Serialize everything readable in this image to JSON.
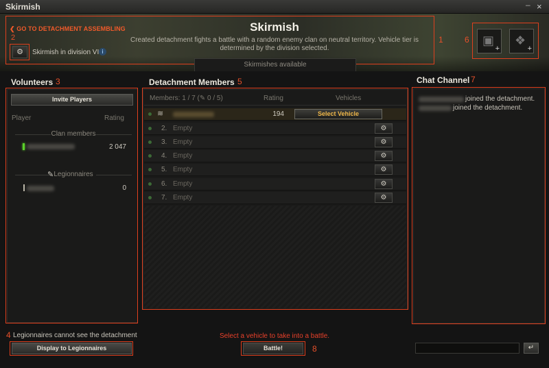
{
  "window": {
    "title": "Skirmish",
    "minimize": "–",
    "close": "×"
  },
  "header": {
    "back_link": "❮ GO TO DETACHMENT ASSEMBLING",
    "title": "Skirmish",
    "description": "Created detachment fights a battle with a random enemy clan on neutral territory. Vehicle tier is determined by the division selected.",
    "division": "Skirmish in division VI",
    "info_icon": "i",
    "availability_tab": "Skirmishes available",
    "settings_icon": "⚙",
    "icon_tiles": [
      {
        "icon": "tank-hull-icon",
        "glyph": "▣",
        "plus": "+"
      },
      {
        "icon": "consumable-icon",
        "glyph": "❖",
        "plus": "+"
      }
    ]
  },
  "annotations": [
    "1",
    "2",
    "3",
    "4",
    "5",
    "6",
    "7",
    "8"
  ],
  "volunteers": {
    "title": "Volunteers",
    "invite_button": "Invite Players",
    "col_player": "Player",
    "col_rating": "Rating",
    "clan_members_label": "Clan members",
    "clan_member": {
      "rating": "2 047"
    },
    "legionnaires_label": "Legionnaires",
    "legionnaire": {
      "rating": "0"
    }
  },
  "detachment": {
    "title": "Detachment Members",
    "members_count": "Members: 1 / 7 (",
    "legion_count": " 0 / 5)",
    "col_rating": "Rating",
    "col_vehicles": "Vehicles",
    "first_member": {
      "rating": "194",
      "select_vehicle": "Select Vehicle"
    },
    "empty_slots": [
      {
        "num": "2.",
        "label": "Empty"
      },
      {
        "num": "3.",
        "label": "Empty"
      },
      {
        "num": "4.",
        "label": "Empty"
      },
      {
        "num": "5.",
        "label": "Empty"
      },
      {
        "num": "6.",
        "label": "Empty"
      },
      {
        "num": "7.",
        "label": "Empty"
      }
    ]
  },
  "chat": {
    "title": "Chat Channel",
    "messages": [
      {
        "text": "joined the detachment."
      },
      {
        "text": "joined the detachment."
      }
    ],
    "send_glyph": "↵"
  },
  "footer": {
    "legionnaires_note": "Legionnaires cannot see the detachment",
    "display_button": "Display to Legionnaires",
    "select_message": "Select a vehicle to take into a battle.",
    "battle_button": "Battle!"
  }
}
